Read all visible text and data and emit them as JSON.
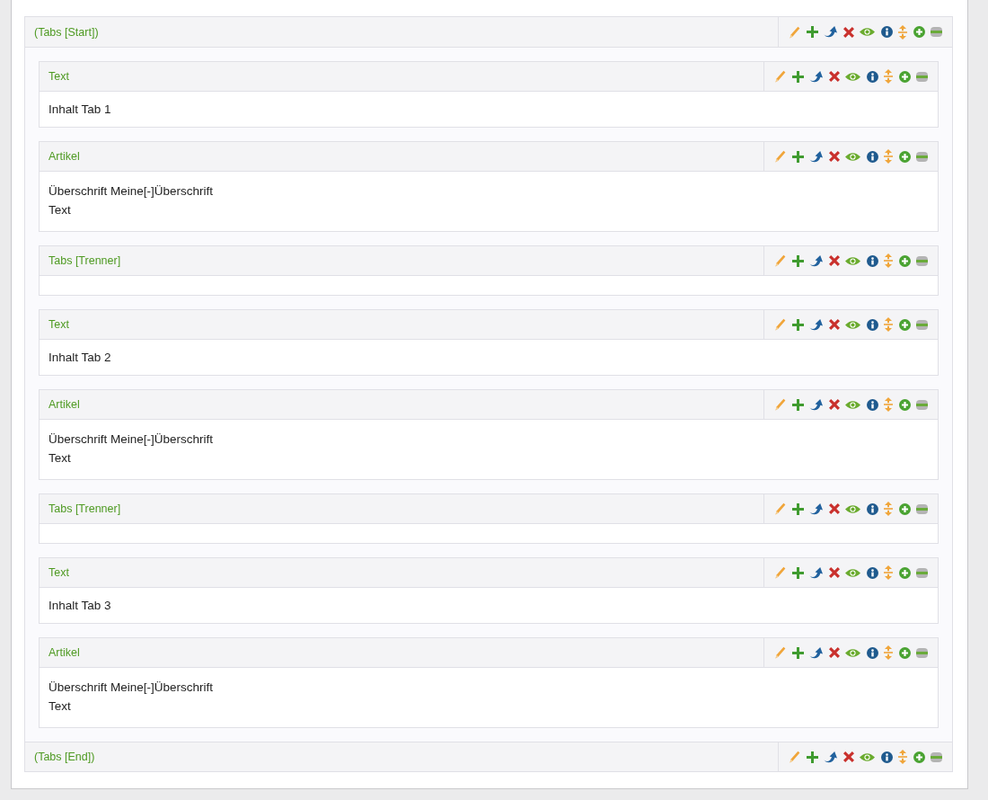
{
  "tabs_block": {
    "start_title": "(Tabs [Start])",
    "items": [
      {
        "title": "Text",
        "lines": [
          "Inhalt Tab 1"
        ]
      },
      {
        "title": "Artikel",
        "lines": [
          "Überschrift Meine[-]Überschrift",
          "Text"
        ]
      },
      {
        "title": "Tabs [Trenner]"
      },
      {
        "title": "Text",
        "lines": [
          "Inhalt Tab 2"
        ]
      },
      {
        "title": "Artikel",
        "lines": [
          "Überschrift Meine[-]Überschrift",
          "Text"
        ]
      },
      {
        "title": "Tabs [Trenner]"
      },
      {
        "title": "Text",
        "lines": [
          "Inhalt Tab 3"
        ]
      },
      {
        "title": "Artikel",
        "lines": [
          "Überschrift Meine[-]Überschrift",
          "Text"
        ]
      }
    ],
    "end_title": "(Tabs [End])"
  }
}
